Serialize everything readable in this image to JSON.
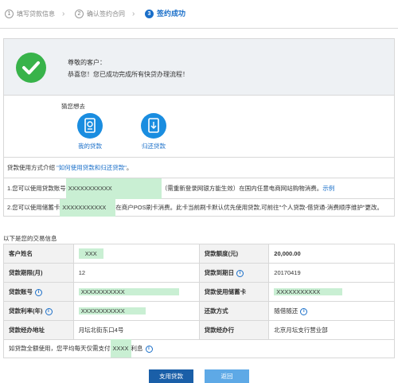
{
  "steps": [
    {
      "num": "1",
      "label": "填写贷款信息"
    },
    {
      "num": "2",
      "label": "确认签约合同"
    },
    {
      "num": "3",
      "label": "签约成功"
    }
  ],
  "step_arrow": "›",
  "success": {
    "greeting": "尊敬的客户：",
    "message": "恭喜您！您已成功完成所有快贷办理流程！"
  },
  "guess": {
    "title": "猜您想去",
    "items": [
      {
        "label": "我的贷款",
        "icon": "my-loan-icon"
      },
      {
        "label": "归还贷款",
        "icon": "repay-loan-icon"
      }
    ]
  },
  "usage": {
    "intro_prefix": "贷款使用方式介绍",
    "intro_link": "\"如何使用贷款和归还贷款\"",
    "intro_suffix": "。",
    "line1_prefix": "1.您可以使用贷款账号",
    "line1_masked": "XXXXXXXXXXX",
    "line1_middle": "（需重新登录网银方能生效）在国内任意电商网站购物消费。",
    "line1_link": "示例",
    "line2_prefix": "2.您可以使用储蓄卡",
    "line2_masked": "XXXXXXXXXXX",
    "line2_suffix": "在商户POS刷卡消费。此卡当前刷卡默认优先使用贷款,可前往\"个人贷款-借贷通-消费顺序维护\"更改。"
  },
  "transaction": {
    "title": "以下是您的交易信息",
    "rows": [
      {
        "l1": "客户姓名",
        "v1": "XXX",
        "l2": "贷款额度(元)",
        "v2": "20,000.00"
      },
      {
        "l1": "贷款期限(月)",
        "v1": "12",
        "l2": "贷款到期日",
        "v2": "20170419"
      },
      {
        "l1": "贷款账号",
        "v1": "XXXXXXXXXXX",
        "l2": "贷款使用储蓄卡",
        "v2": "XXXXXXXXXXX"
      },
      {
        "l1": "贷款利率(年)",
        "v1": "XXXXXXXXXXX",
        "l2": "还款方式",
        "v2": "随借随还"
      },
      {
        "l1": "贷款经办地址",
        "v1": "月坛北街东口4号",
        "l2": "贷款经办行",
        "v2": "北京月坛支行营业部"
      }
    ],
    "footer_prefix": "如贷款全额使用，您平均每天仅需支付",
    "footer_masked": "XXXX",
    "footer_suffix": "利息"
  },
  "buttons": {
    "use_loan": "支用贷款",
    "back": "返回"
  },
  "colors": {
    "primary": "#1a6fc9",
    "success": "#38b34a",
    "mask_highlight": "#c9efd3",
    "amount_red": "#d6251f"
  }
}
